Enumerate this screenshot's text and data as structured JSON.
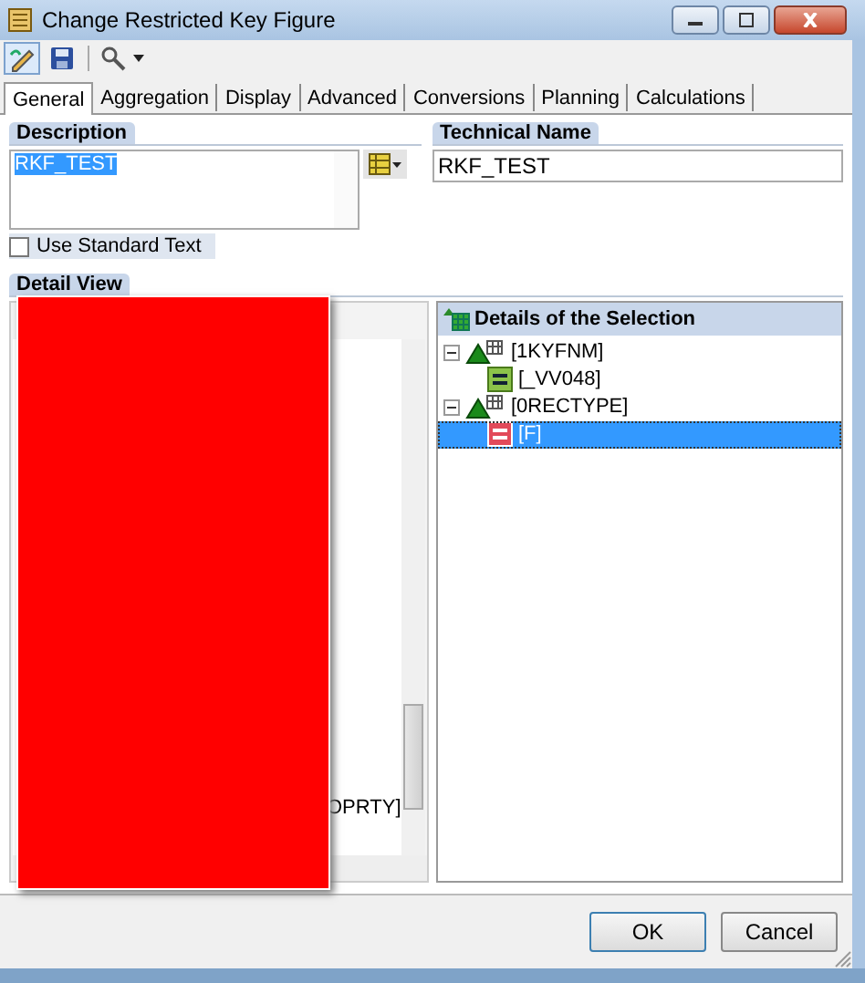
{
  "window": {
    "title": "Change Restricted Key Figure"
  },
  "tabs": [
    {
      "label": "General",
      "selected": true
    },
    {
      "label": "Aggregation",
      "selected": false
    },
    {
      "label": "Display",
      "selected": false
    },
    {
      "label": "Advanced",
      "selected": false
    },
    {
      "label": "Conversions",
      "selected": false
    },
    {
      "label": "Planning",
      "selected": false
    },
    {
      "label": "Calculations",
      "selected": false
    }
  ],
  "description": {
    "label": "Description",
    "value": "RKF_TEST"
  },
  "technical_name": {
    "label": "Technical Name",
    "value": "RKF_TEST"
  },
  "use_standard_text": {
    "label": "Use Standard Text",
    "checked": false
  },
  "detail_view": {
    "label": "Detail View",
    "left_tree_text": "OPRTY]",
    "selection": {
      "title": "Details of the Selection",
      "tree": [
        {
          "label": "[1KYFNM]",
          "expanded": true,
          "selected": false,
          "children": [
            {
              "label": "[_VV048]",
              "kind": "include",
              "selected": false
            }
          ]
        },
        {
          "label": "[0RECTYPE]",
          "expanded": true,
          "selected": false,
          "children": [
            {
              "label": "[F]",
              "kind": "exclude",
              "selected": true
            }
          ]
        }
      ]
    }
  },
  "buttons": [
    "OK",
    "Cancel"
  ]
}
